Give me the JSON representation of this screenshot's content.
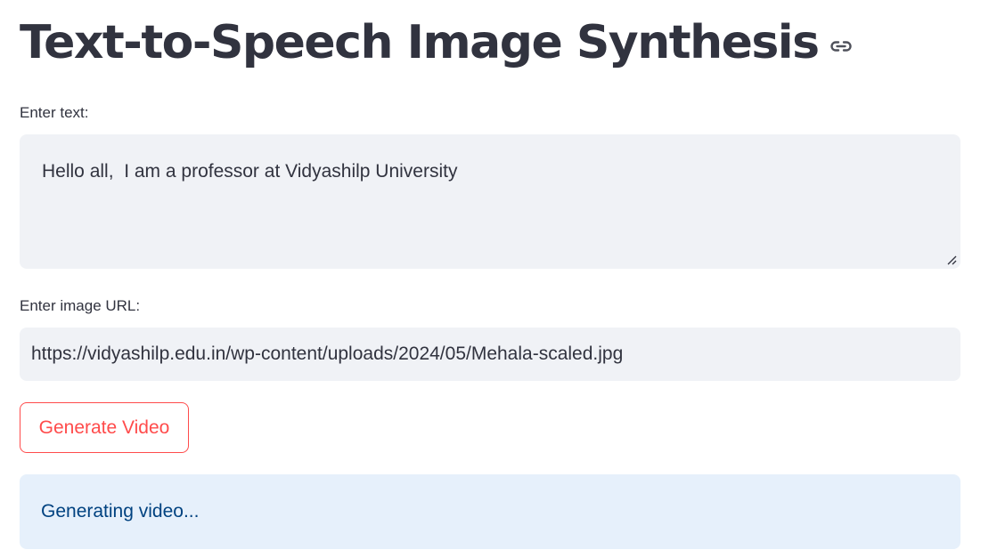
{
  "header": {
    "title": "Text-to-Speech Image Synthesis",
    "anchor_icon": "link-icon"
  },
  "text_field": {
    "label": "Enter text:",
    "value": "Hello all,  I am a professor at Vidyashilp University"
  },
  "url_field": {
    "label": "Enter image URL:",
    "value": "https://vidyashilp.edu.in/wp-content/uploads/2024/05/Mehala-scaled.jpg"
  },
  "actions": {
    "generate_label": "Generate Video"
  },
  "status": {
    "message": "Generating video..."
  },
  "colors": {
    "primary": "#ff4b4b",
    "text": "#31333f",
    "input_bg": "#f0f2f6",
    "info_bg": "#e6f0fb",
    "info_text": "#004280"
  }
}
